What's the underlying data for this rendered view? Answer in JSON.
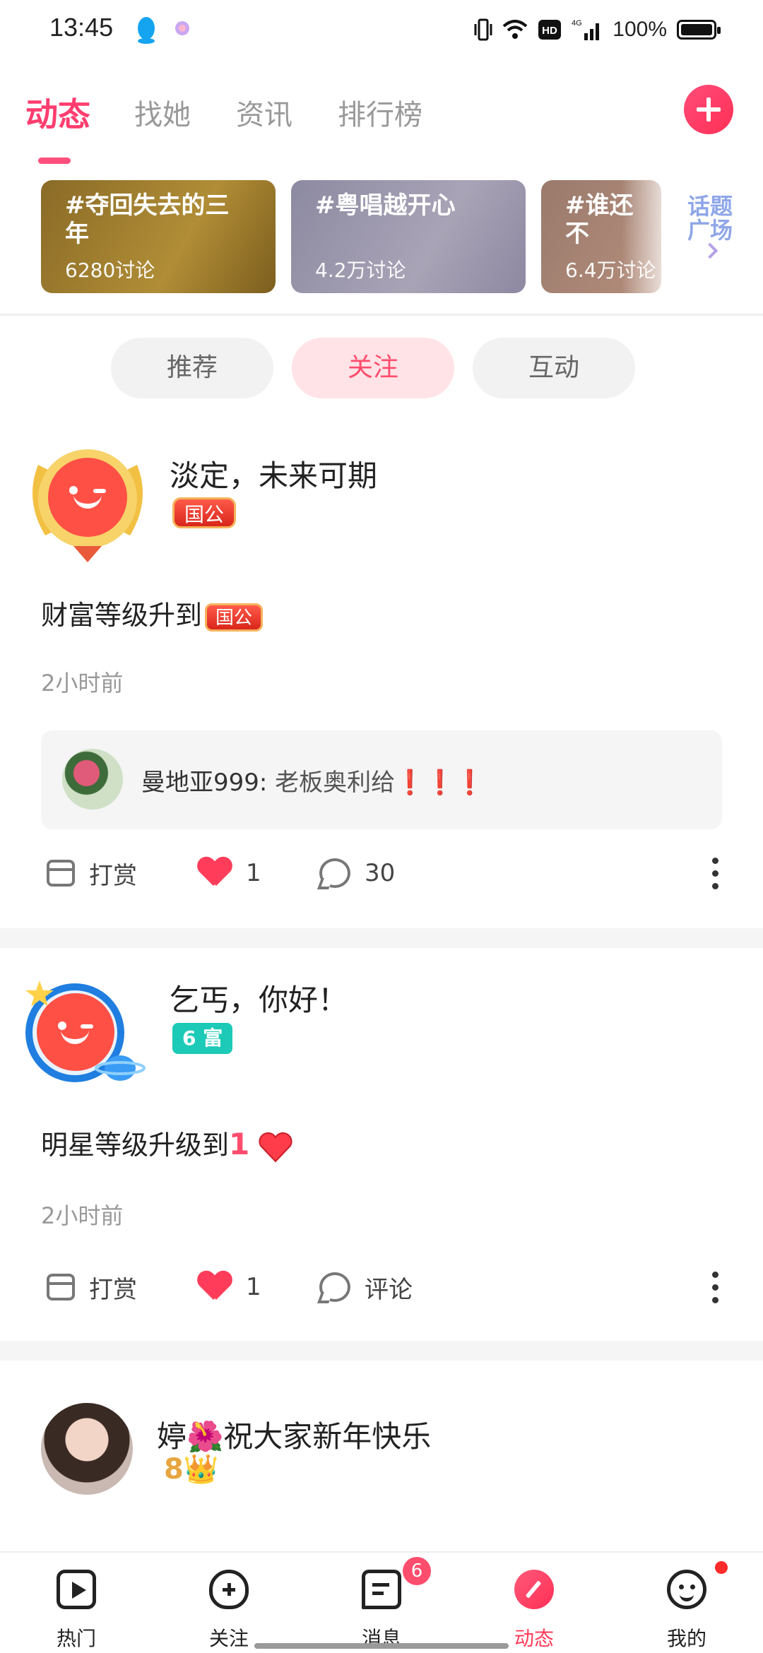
{
  "status_bar": {
    "time": "13:45",
    "network": "4G",
    "battery": "100%",
    "icons": [
      "qq-icon",
      "app-icon",
      "vibrate-icon",
      "wifi-icon",
      "hd-icon",
      "signal-icon",
      "battery-icon"
    ]
  },
  "top_tabs": [
    {
      "label": "动态",
      "active": true
    },
    {
      "label": "找她",
      "active": false
    },
    {
      "label": "资讯",
      "active": false
    },
    {
      "label": "排行榜",
      "active": false
    }
  ],
  "topics": [
    {
      "title": "#夺回失去的三年",
      "count": "6280讨论"
    },
    {
      "title": "#粤唱越开心",
      "count": "4.2万讨论"
    },
    {
      "title": "#谁还不",
      "count": "6.4万讨论"
    }
  ],
  "topic_square": {
    "label": "话题广场"
  },
  "filters": [
    {
      "label": "推荐",
      "active": false
    },
    {
      "label": "关注",
      "active": true
    },
    {
      "label": "互动",
      "active": false
    }
  ],
  "posts": [
    {
      "username": "淡定，未来可期",
      "badge": "国公",
      "content": "财富等级升到",
      "content_badge": "国公",
      "time": "2小时前",
      "comment": {
        "author": "曼地亚999",
        "text": "老板奥利给",
        "suffix": "❗❗❗"
      },
      "actions": {
        "reward": "打赏",
        "likes": "1",
        "comments": "30"
      }
    },
    {
      "username": "乞丐，你好！",
      "badge": "6 富",
      "content": "明星等级升级到",
      "level_num": "1",
      "time": "2小时前",
      "actions": {
        "reward": "打赏",
        "likes": "1",
        "comments": "评论"
      }
    },
    {
      "username": "婷🌺祝大家新年快乐",
      "level": "8👑"
    }
  ],
  "bottom_nav": [
    {
      "label": "热门",
      "icon": "play-icon",
      "active": false
    },
    {
      "label": "关注",
      "icon": "heart-plus-icon",
      "active": false
    },
    {
      "label": "消息",
      "icon": "message-icon",
      "active": false,
      "badge": "6"
    },
    {
      "label": "动态",
      "icon": "pencil-icon",
      "active": true
    },
    {
      "label": "我的",
      "icon": "smile-icon",
      "active": false
    }
  ],
  "colors": {
    "accent": "#ff3d6e",
    "teal": "#1ccab7"
  }
}
